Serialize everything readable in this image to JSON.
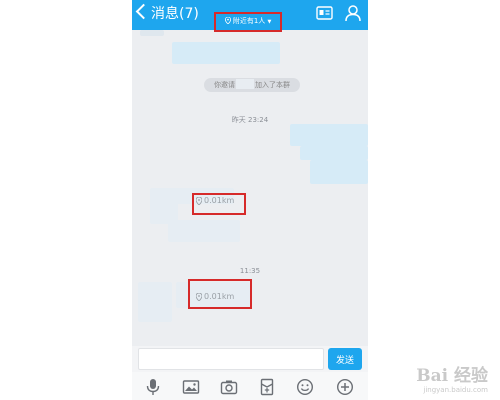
{
  "header": {
    "back_label": "消息(7)",
    "nearby_label": "附近有1人",
    "bg_color": "#1ea6ee",
    "icons": [
      "chevron-left-icon",
      "location-pin-icon",
      "profile-card-icon",
      "person-icon"
    ]
  },
  "chat": {
    "system_tip": {
      "prefix": "你邀请",
      "suffix": "加入了本群"
    },
    "timestamps": [
      "昨天 23:24",
      "11:35"
    ],
    "locations": [
      "0.01km",
      "0.01km"
    ]
  },
  "input": {
    "value": "",
    "placeholder": ""
  },
  "send_label": "发送",
  "toolbar": {
    "icons": [
      "microphone-icon",
      "image-icon",
      "camera-icon",
      "red-packet-icon",
      "emoji-icon",
      "plus-icon"
    ]
  },
  "watermark": {
    "title": "Bai 经验",
    "url": "jingyan.baidu.com"
  }
}
